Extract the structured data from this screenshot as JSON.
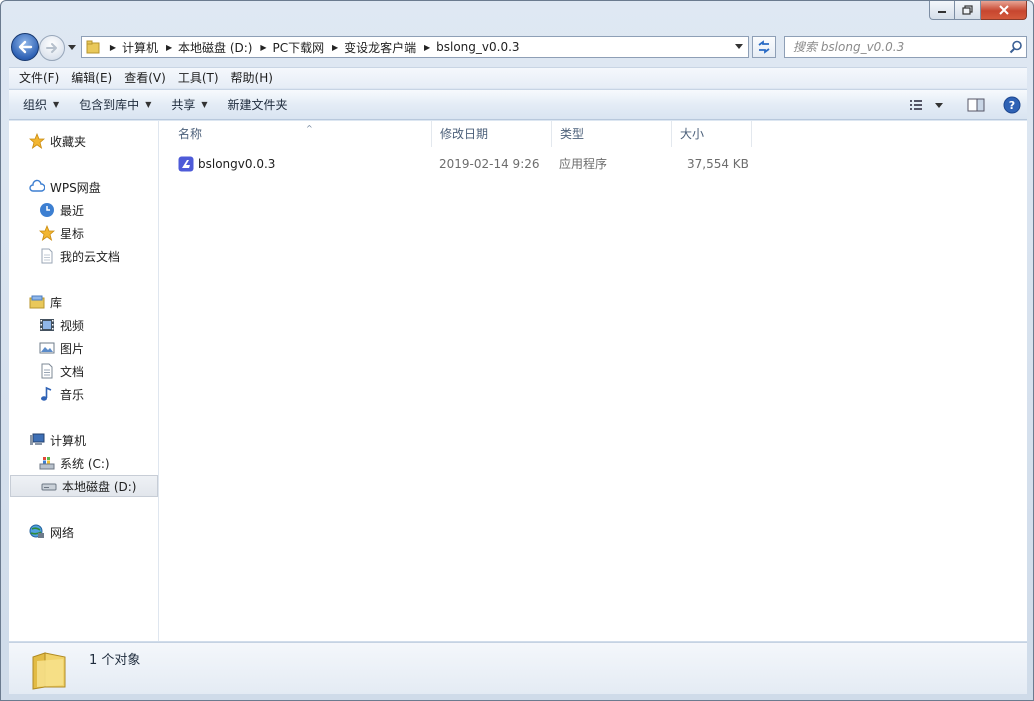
{
  "window": {
    "caption": {
      "minimize": "minimize",
      "maximize": "maximize",
      "close": "close"
    }
  },
  "address": {
    "breadcrumbs": [
      "计算机",
      "本地磁盘 (D:)",
      "PC下载网",
      "变设龙客户端",
      "bslong_v0.0.3"
    ]
  },
  "search": {
    "placeholder": "搜索 bslong_v0.0.3"
  },
  "menubar": {
    "items": [
      "文件(F)",
      "编辑(E)",
      "查看(V)",
      "工具(T)",
      "帮助(H)"
    ]
  },
  "commandbar": {
    "organize": "组织",
    "include_in_library": "包含到库中",
    "share": "共享",
    "new_folder": "新建文件夹"
  },
  "navpane": {
    "favorites": "收藏夹",
    "wps": "WPS网盘",
    "recent": "最近",
    "starred": "星标",
    "my_cloud_docs": "我的云文档",
    "libraries": "库",
    "videos": "视频",
    "pictures": "图片",
    "documents": "文档",
    "music": "音乐",
    "computer": "计算机",
    "drive_c": "系统 (C:)",
    "drive_d": "本地磁盘 (D:)",
    "network": "网络"
  },
  "columns": {
    "name": "名称",
    "date": "修改日期",
    "type": "类型",
    "size": "大小"
  },
  "files": [
    {
      "name": "bslongv0.0.3",
      "date": "2019-02-14 9:26",
      "type": "应用程序",
      "size": "37,554 KB"
    }
  ],
  "details": {
    "count": "1 个对象"
  },
  "colors": {
    "accent": "#2f62b5",
    "frame": "#dfe8f3",
    "selected": "#e2e6ec"
  }
}
